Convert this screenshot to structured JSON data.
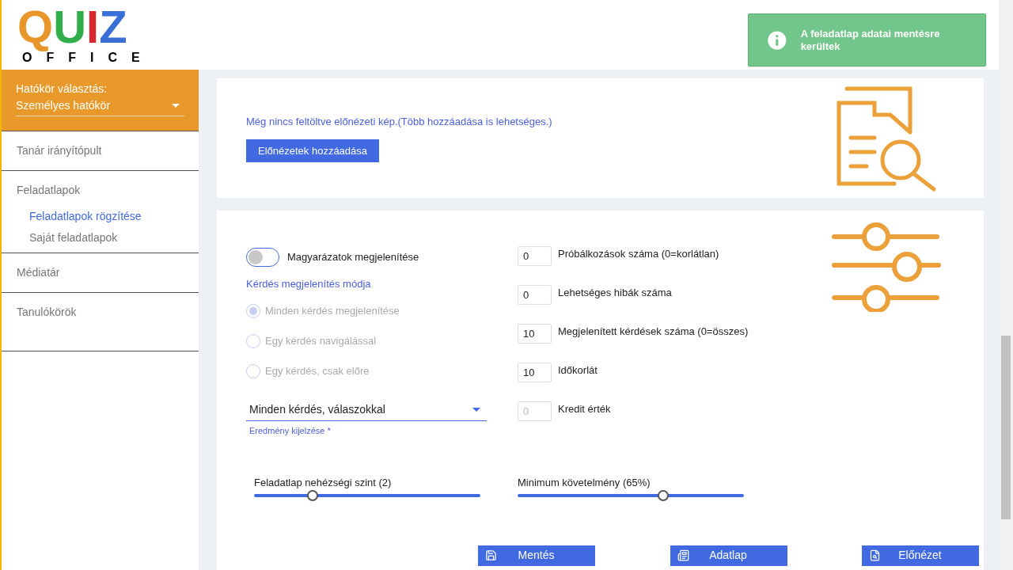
{
  "logo": {
    "letters": [
      {
        "text": "Q",
        "color": "#e8962a"
      },
      {
        "text": "U",
        "color": "#2fae4a"
      },
      {
        "text": "I",
        "color": "#d8262c"
      },
      {
        "text": "Z",
        "color": "#3a6fd8"
      }
    ],
    "subtitle": "OFFICE"
  },
  "sidebar": {
    "scope": {
      "label": "Hatókör választás:",
      "value": "Személyes hatókör"
    },
    "items": [
      {
        "label": "Tanár irányítópult",
        "selected": false
      },
      {
        "label": "Feladatlapok",
        "selected": false,
        "children": [
          {
            "label": "Feladatlapok rögzítése",
            "selected": true
          },
          {
            "label": "Saját feladatlapok",
            "selected": false
          }
        ]
      },
      {
        "label": "Médiatár",
        "selected": false
      },
      {
        "label": "Tanulókörök",
        "selected": false
      }
    ]
  },
  "toast": {
    "text": "A feladatlap adatai mentésre kerültek"
  },
  "preview": {
    "message": "Még nincs feltöltve előnézeti kép.(Több hozzáadása is lehetséges.)",
    "button": "Előnézetek hozzáadása"
  },
  "settings": {
    "toggle": {
      "label": "Magyarázatok megjelenítése",
      "on": false
    },
    "mode_title": "Kérdés megjelenítés módja",
    "modes": [
      {
        "label": "Minden kérdés megjelenítése",
        "selected": true,
        "disabled": true
      },
      {
        "label": "Egy kérdés navigálással",
        "selected": false,
        "disabled": true
      },
      {
        "label": "Egy kérdés, csak előre",
        "selected": false,
        "disabled": true
      }
    ],
    "result": {
      "value": "Minden kérdés, válaszokkal",
      "label": "Eredmény kijelzése *"
    },
    "fields": [
      {
        "value": "0",
        "label": "Próbálkozások száma (0=korlátlan)",
        "disabled": false
      },
      {
        "value": "0",
        "label": "Lehetséges hibák száma",
        "disabled": false
      },
      {
        "value": "10",
        "label": "Megjelenített kérdések száma (0=összes)",
        "disabled": false
      },
      {
        "value": "10",
        "label": "Időkorlát",
        "disabled": false
      },
      {
        "value": "0",
        "label": "Kredit érték",
        "disabled": true
      }
    ],
    "sliders": [
      {
        "label": "Feladatlap nehézségi szint (2)",
        "level": 0.245
      },
      {
        "label": "Minimum követelmény (65%)",
        "level": 0.65
      }
    ]
  },
  "actions": [
    {
      "label": "Mentés",
      "kind": "save"
    },
    {
      "label": "Adatlap",
      "kind": "sheet"
    },
    {
      "label": "Előnézet",
      "kind": "preview"
    }
  ]
}
